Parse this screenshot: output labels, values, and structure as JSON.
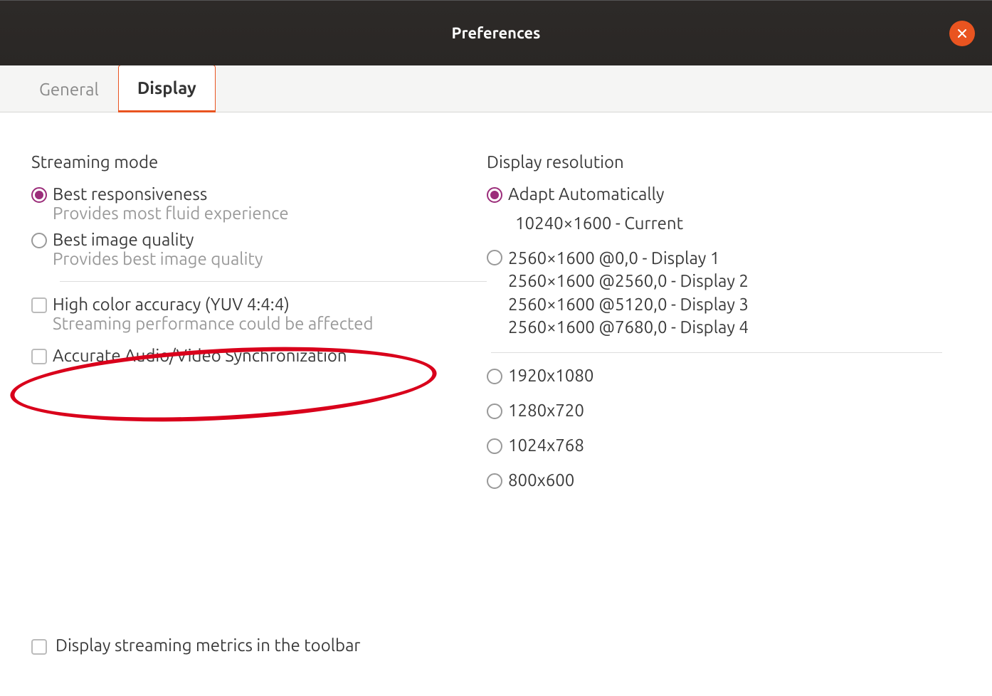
{
  "titlebar": {
    "title": "Preferences"
  },
  "tabs": {
    "general": "General",
    "display": "Display"
  },
  "streaming": {
    "heading": "Streaming mode",
    "best_resp_label": "Best responsiveness",
    "best_resp_sub": "Provides most fluid experience",
    "best_img_label": "Best image quality",
    "best_img_sub": "Provides best image quality",
    "high_color_label": "High color accuracy (YUV 4:4:4)",
    "high_color_sub": "Streaming performance could be affected",
    "av_sync_label": "Accurate Audio/Video Synchronization"
  },
  "resolution": {
    "heading": "Display resolution",
    "adapt_label": "Adapt Automatically",
    "current_label": "10240×1600 - Current",
    "displays": {
      "d1": "2560×1600 @0,0 - Display 1",
      "d2": "2560×1600 @2560,0 - Display 2",
      "d3": "2560×1600 @5120,0 - Display 3",
      "d4": "2560×1600 @7680,0 - Display 4"
    },
    "r1080": "1920x1080",
    "r720": "1280x720",
    "r768": "1024x768",
    "r600": "800x600"
  },
  "footer": {
    "metrics_label": "Display streaming metrics in the toolbar"
  }
}
